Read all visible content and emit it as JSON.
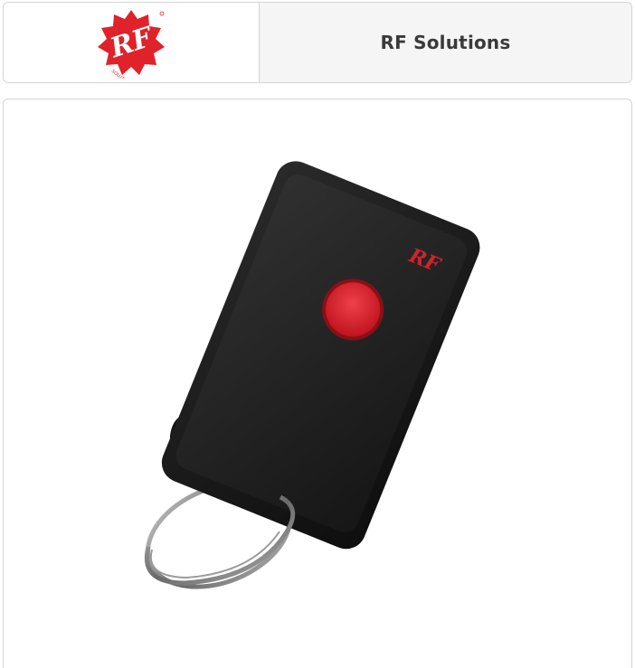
{
  "header": {
    "logo": {
      "icon": "rf-solutions-logo",
      "text": "RF",
      "ring_text": "SOLUTIONS",
      "color": "#e0222b"
    },
    "brand_name": "RF Solutions"
  },
  "product": {
    "image": {
      "icon": "keyfob-remote-image",
      "logo_text": "RF",
      "body_color": "#1c1c1c",
      "button_color": "#e0303a"
    }
  }
}
